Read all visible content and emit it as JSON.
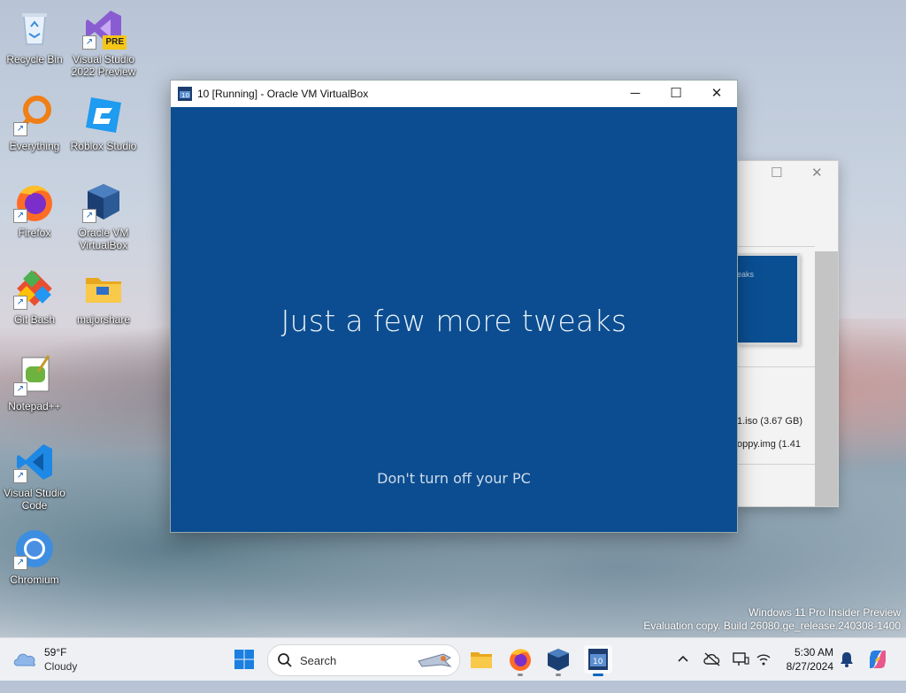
{
  "desktop": {
    "icons": [
      {
        "label": "Recycle Bin",
        "icon": "recycle-bin-icon"
      },
      {
        "label": "Visual Studio 2022 Preview",
        "icon": "visual-studio-preview-icon",
        "badge": "PRE"
      },
      {
        "label": "Everything",
        "icon": "everything-search-icon"
      },
      {
        "label": "Roblox Studio",
        "icon": "roblox-studio-icon"
      },
      {
        "label": "Firefox",
        "icon": "firefox-icon"
      },
      {
        "label": "Oracle VM VirtualBox",
        "icon": "virtualbox-icon"
      },
      {
        "label": "Git Bash",
        "icon": "git-bash-icon"
      },
      {
        "label": "majorshare",
        "icon": "folder-icon"
      },
      {
        "label": "Notepad++",
        "icon": "notepad-plus-plus-icon"
      },
      {
        "label": "Visual Studio Code",
        "icon": "vscode-icon"
      },
      {
        "label": "Chromium",
        "icon": "chromium-icon"
      }
    ]
  },
  "vbox_window": {
    "title": "10 [Running] - Oracle VM VirtualBox",
    "minimize": "─",
    "maximize": "☐",
    "close": "✕",
    "screen": {
      "heading": "Just a few more tweaks",
      "subtext": "Don't turn off your PC"
    }
  },
  "background_window": {
    "preview_text": "eaks",
    "line1": "1.iso (3.67 GB)",
    "line2": "oppy.img (1.41",
    "maximize": "☐",
    "close": "✕"
  },
  "watermark": {
    "line1": "Windows 11 Pro Insider Preview",
    "line2": "Evaluation copy. Build 26080.ge_release.240308-1400"
  },
  "taskbar": {
    "weather": {
      "temp": "59°F",
      "condition": "Cloudy"
    },
    "search_placeholder": "Search",
    "clock": {
      "time": "5:30 AM",
      "date": "8/27/2024"
    }
  },
  "colors": {
    "vm_screen": "#0b4d90",
    "accent": "#0067c0"
  }
}
